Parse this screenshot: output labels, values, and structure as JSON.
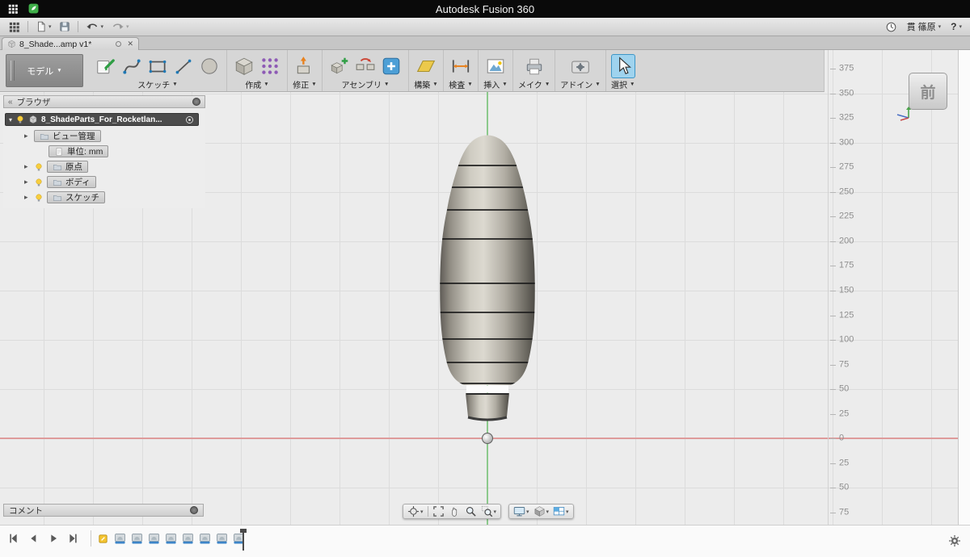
{
  "menubar": {
    "title": "Autodesk Fusion 360"
  },
  "qat": {
    "user": "貫 篠原",
    "help": "?"
  },
  "tabbar": {
    "tab_label": "8_Shade...amp v1*"
  },
  "ribbon": {
    "workspace": "モデル",
    "groups": [
      {
        "label": "スケッチ",
        "icons": [
          "create-sketch",
          "spline",
          "rectangle",
          "line",
          "circle"
        ]
      },
      {
        "label": "作成",
        "icons": [
          "box",
          "pattern"
        ]
      },
      {
        "label": "修正",
        "icons": [
          "press-pull"
        ]
      },
      {
        "label": "アセンブリ",
        "icons": [
          "new-component",
          "joint",
          "insert"
        ]
      },
      {
        "label": "構築",
        "icons": [
          "plane"
        ]
      },
      {
        "label": "検査",
        "icons": [
          "measure"
        ]
      },
      {
        "label": "挿入",
        "icons": [
          "canvas"
        ]
      },
      {
        "label": "メイク",
        "icons": [
          "make"
        ]
      },
      {
        "label": "アドイン",
        "icons": [
          "addin"
        ]
      },
      {
        "label": "選択",
        "icons": [
          "select"
        ],
        "highlighted": "select"
      }
    ]
  },
  "browser": {
    "title": "ブラウザ",
    "root_label": "8_ShadeParts_For_Rocketlan...",
    "items": [
      {
        "label": "ビュー管理",
        "arrow": true,
        "bulb": false,
        "icon": "folder",
        "indent": false
      },
      {
        "label": "単位: mm",
        "arrow": false,
        "bulb": false,
        "icon": "document",
        "indent": true
      },
      {
        "label": "原点",
        "arrow": true,
        "bulb": true,
        "icon": "folder",
        "indent": false
      },
      {
        "label": "ボディ",
        "arrow": true,
        "bulb": true,
        "icon": "folder",
        "indent": false
      },
      {
        "label": "スケッチ",
        "arrow": true,
        "bulb": true,
        "icon": "folder",
        "indent": false
      }
    ]
  },
  "viewport": {
    "viewcube_label": "前",
    "ruler_values": [
      "375",
      "350",
      "325",
      "300",
      "275",
      "250",
      "225",
      "200",
      "175",
      "150",
      "125",
      "100",
      "75",
      "50",
      "25",
      "0",
      "25",
      "50",
      "75"
    ],
    "x_axis_color": "#de9b9b",
    "y_axis_color": "#8cc98c",
    "grid_color": "#dcdcdc"
  },
  "navbar": {
    "group1": [
      {
        "icon": "orbit",
        "dd": true,
        "divider_after": true
      },
      {
        "icon": "fit",
        "dd": false
      },
      {
        "icon": "pan",
        "dd": false
      },
      {
        "icon": "zoom",
        "dd": false
      },
      {
        "icon": "zoom-window",
        "dd": true
      }
    ],
    "group2": [
      {
        "icon": "display",
        "dd": true
      },
      {
        "icon": "visual-style",
        "dd": true
      },
      {
        "icon": "viewports",
        "dd": true
      }
    ]
  },
  "comments": {
    "label": "コメント"
  },
  "timeline": {
    "controls": [
      "skip-start",
      "step-back",
      "play",
      "skip-end"
    ],
    "marker": "sketch-marker",
    "feature_icons": [
      "feature",
      "feature",
      "feature",
      "feature",
      "feature",
      "feature",
      "feature",
      "feature"
    ]
  },
  "glyphs": {
    "caret": "▼",
    "caret_small": "▾",
    "close": "✕",
    "expand": "▸",
    "collapse": "«"
  }
}
